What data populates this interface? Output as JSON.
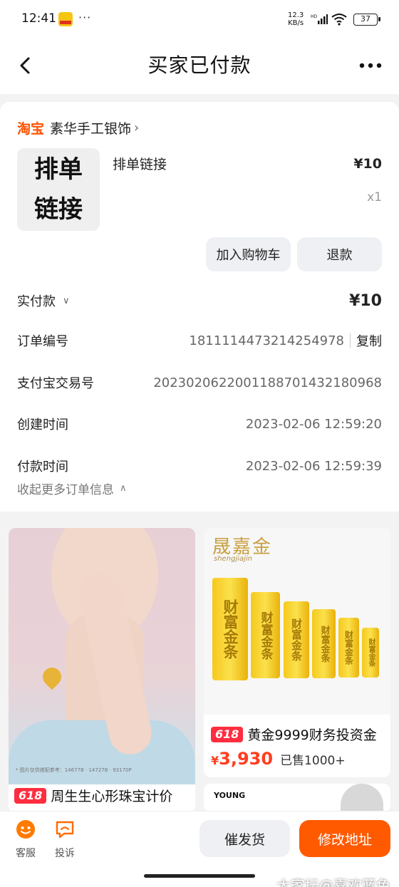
{
  "status_bar": {
    "time": "12:41",
    "app_badge": "美团",
    "dots": "···",
    "speed_value": "12.3",
    "speed_unit": "KB/s",
    "network": "HD",
    "battery": "37"
  },
  "nav": {
    "title": "买家已付款",
    "back_icon": "back-arrow-icon",
    "more_icon": "more-dots-icon"
  },
  "shop": {
    "platform": "淘宝",
    "name": "素华手工银饰",
    "chevron": "›"
  },
  "item": {
    "thumb_line1": "排单",
    "thumb_line2": "链接",
    "title": "排单链接",
    "price": "¥10",
    "quantity": "x1",
    "add_cart_label": "加入购物车",
    "refund_label": "退款"
  },
  "order_info": {
    "paid_label": "实付款",
    "paid_chevron": "∨",
    "paid_amount": "¥10",
    "order_no_label": "订单编号",
    "order_no": "1811114473214254978",
    "copy_label": "复制",
    "alipay_label": "支付宝交易号",
    "alipay_no": "2023020622001188701432180968",
    "created_label": "创建时间",
    "created_time": "2023-02-06 12:59:20",
    "paid_time_label": "付款时间",
    "paid_time": "2023-02-06 12:59:39",
    "collapse_label": "收起更多订单信息",
    "collapse_chevron": "∧"
  },
  "recommendations": {
    "left": {
      "tag": "618",
      "title": "周生生心形珠宝计价",
      "caption": "* 图片仅供搭配参考：14677B · 14727B · 93170P"
    },
    "right": {
      "brand_cn": "晟嘉金",
      "brand_en": "shengjiajin",
      "bar_text": "财富金条",
      "tag": "618",
      "title": "黄金9999财务投资金",
      "price_symbol": "¥",
      "price": "3,930",
      "sold": "已售1000+"
    },
    "right2": {
      "logo": "YOUNG"
    }
  },
  "bottom_bar": {
    "service_label": "客服",
    "complain_label": "投诉",
    "urge_label": "催发货",
    "modify_label": "修改地址",
    "watermark": "大家坛@喜欢蓝色"
  },
  "colors": {
    "accent": "#ff5a00",
    "taobao_orange": "#ff5000",
    "price_red": "#ff3d1f",
    "tag_red": "#ff2d3f",
    "gray_button": "#eef0f3"
  }
}
